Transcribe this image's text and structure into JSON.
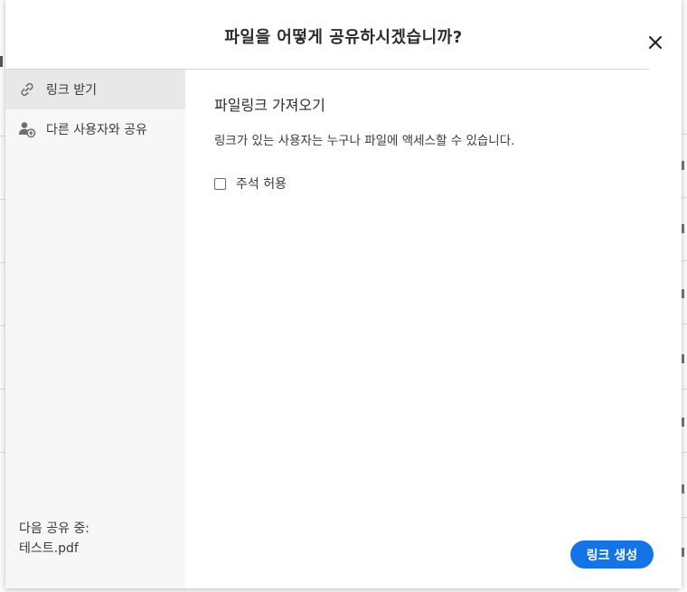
{
  "dialog": {
    "title": "파일을 어떻게 공유하시겠습니까?",
    "close_icon": "close-icon"
  },
  "sidebar": {
    "items": [
      {
        "label": "링크 받기",
        "icon": "link-icon",
        "active": true
      },
      {
        "label": "다른 사용자와 공유",
        "icon": "add-user-icon",
        "active": false
      }
    ],
    "sharing_label": "다음 공유 중:",
    "file_name": "테스트.pdf"
  },
  "content": {
    "section_title": "파일링크 가져오기",
    "description": "링크가 있는 사용자는 누구나 파일에 액세스할 수 있습니다.",
    "checkbox_label": "주석 허용",
    "checkbox_checked": false,
    "create_link_button": "링크 생성"
  },
  "colors": {
    "accent": "#1473e6",
    "sidebar_bg": "#f7f7f7",
    "sidebar_active_bg": "#e8e8e8"
  }
}
